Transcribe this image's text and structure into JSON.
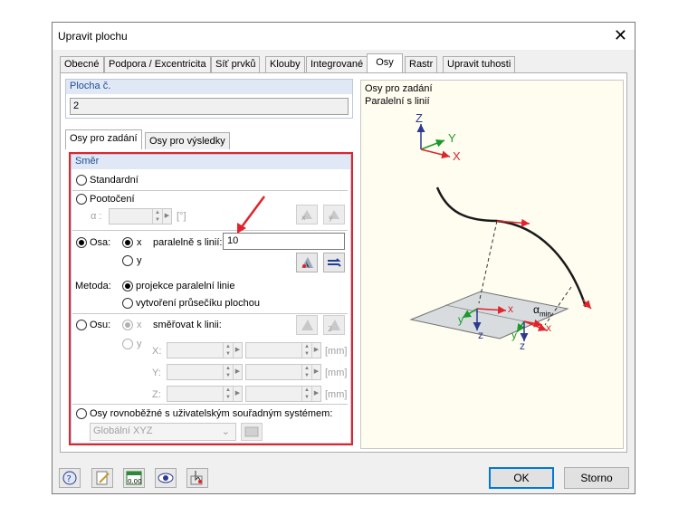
{
  "window": {
    "title": "Upravit plochu",
    "close_glyph": "✕"
  },
  "tabs": [
    {
      "label": "Obecné"
    },
    {
      "label": "Podpora / Excentricita"
    },
    {
      "label": "Síť prvků"
    },
    {
      "label": "Klouby"
    },
    {
      "label": "Integrované"
    },
    {
      "label": "Osy",
      "active": true
    },
    {
      "label": "Rastr"
    },
    {
      "label": "Upravit tuhosti"
    }
  ],
  "surface": {
    "label": "Plocha č.",
    "value": "2"
  },
  "subtabs": [
    {
      "label": "Osy pro zadání",
      "active": true
    },
    {
      "label": "Osy pro výsledky"
    }
  ],
  "direction": {
    "header": "Směr",
    "standard_label": "Standardní",
    "rotation_label": "Pootočení",
    "alpha_label": "α :",
    "alpha_unit": "[°]",
    "axis1_label": "Osa:",
    "axis1_x": "x",
    "axis1_y": "y",
    "parallel_label": "paralelně s linií:",
    "parallel_value": "10",
    "method_label": "Metoda:",
    "method_opt1": "projekce paralelní linie",
    "method_opt2": "vytvoření průsečíku plochou",
    "axis2_label": "Osu:",
    "axis2_x": "x",
    "axis2_y": "y",
    "direct_label": "směřovat k linii:",
    "coord_x": "X:",
    "coord_y": "Y:",
    "coord_z": "Z:",
    "unit_mm": "[mm]",
    "ucs_label": "Osy rovnoběžné s uživatelským souřadným systémem:",
    "ucs_value": "Globální XYZ"
  },
  "preview": {
    "line1": "Osy pro zadání",
    "line2": "Paralelní s linií",
    "axis_Z": "Z",
    "axis_Y": "Y",
    "axis_X": "X",
    "alpha_min": "α",
    "alpha_min_sub": "min",
    "lbl_x1": "x",
    "lbl_y1": "y",
    "lbl_z1": "z",
    "lbl_x2": "x",
    "lbl_y2": "y",
    "lbl_z2": "z"
  },
  "buttons": {
    "ok": "OK",
    "cancel": "Storno"
  },
  "toolbar_icons": [
    "help-icon",
    "edit-icon",
    "units-icon",
    "view-icon",
    "select-icon"
  ],
  "colors": {
    "accent": "#e0242b",
    "group_header_bg": "#dfe8f4",
    "group_header_text": "#1f4e9a",
    "preview_bg": "#fffdf0"
  }
}
